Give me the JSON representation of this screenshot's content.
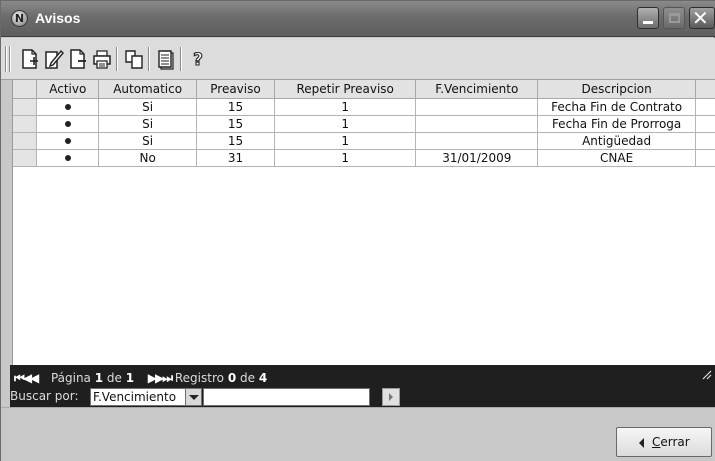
{
  "window": {
    "title": "Avisos",
    "app_icon": "N"
  },
  "grid": {
    "columns": [
      "Activo",
      "Automatico",
      "Preaviso",
      "Repetir Preaviso",
      "F.Vencimiento",
      "Descripcion"
    ],
    "rows": [
      {
        "activo": "•",
        "automatico": "Si",
        "preaviso": "15",
        "repetir": "1",
        "vencimiento": "",
        "descripcion": "Fecha Fin de Contrato"
      },
      {
        "activo": "•",
        "automatico": "Si",
        "preaviso": "15",
        "repetir": "1",
        "vencimiento": "",
        "descripcion": "Fecha Fin de Prorroga"
      },
      {
        "activo": "•",
        "automatico": "Si",
        "preaviso": "15",
        "repetir": "1",
        "vencimiento": "",
        "descripcion": "Antigüedad"
      },
      {
        "activo": "•",
        "automatico": "No",
        "preaviso": "31",
        "repetir": "1",
        "vencimiento": "31/01/2009",
        "descripcion": "CNAE"
      }
    ]
  },
  "pager": {
    "pagina_label": "Página",
    "pagina_value": "1",
    "de_label": "de",
    "pagina_total": "1",
    "registro_label": "Registro",
    "registro_value": "0",
    "registro_total": "4"
  },
  "search": {
    "label": "Buscar por:",
    "field_value": "F.Vencimiento",
    "query_value": ""
  },
  "footer": {
    "cerrar_label_underlined": "C",
    "cerrar_label_rest": "errar"
  }
}
